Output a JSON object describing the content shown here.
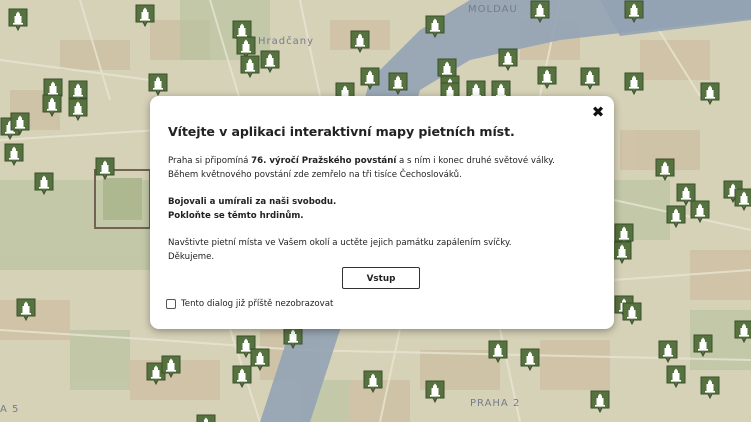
{
  "map": {
    "labels": [
      "MOLDAU",
      "Hradčany",
      "PRAHA 2",
      "A 5"
    ],
    "colors": {
      "paper": "#d4d0b4",
      "water": "#8a9bb0",
      "block": "#c3a987",
      "green": "#b9c2a0",
      "marker": "#4c6b34"
    },
    "marker_icon": "memorial-icon"
  },
  "dialog": {
    "title": "Vítejte v aplikaci interaktivní mapy pietních míst.",
    "close_icon": "close-icon",
    "close_symbol": "✖",
    "p1": {
      "line1_before": "Praha si připomíná ",
      "line1_bold": "76. výročí Pražského povstání",
      "line1_after": " a s ním i konec druhé světové války.",
      "line2": "Během květnového povstání zde zemřelo na tři tisíce Čechoslováků."
    },
    "p2": {
      "line1": "Bojovali a umírali za naši svobodu.",
      "line2": "Pokloňte se těmto hrdinům."
    },
    "p3": {
      "line1": "Navštivte pietní místa ve Vašem okolí a uctěte jejich památku zapálením svíčky.",
      "line2": "Děkujeme."
    },
    "button_label": "Vstup",
    "checkbox_label": "Tento dialog již příště nezobrazovat"
  }
}
